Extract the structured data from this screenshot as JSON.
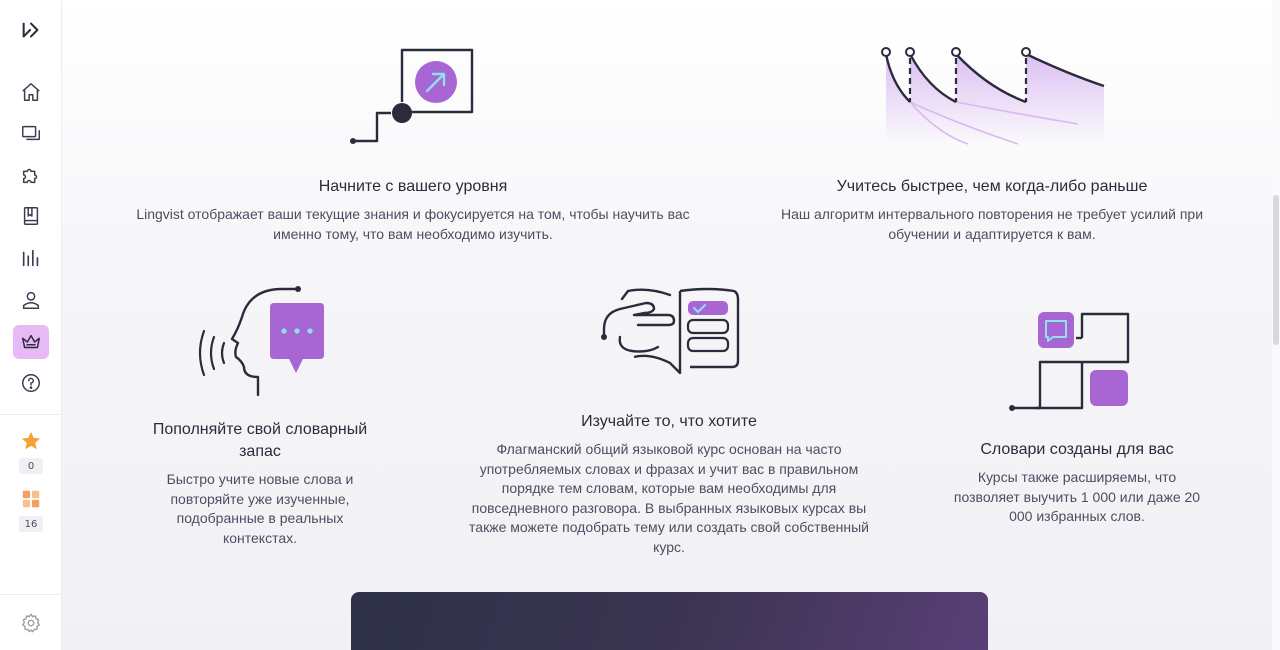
{
  "sidebar": {
    "logo_icon": "lingvist-logo-icon",
    "items": [
      {
        "name": "home",
        "icon": "home-icon"
      },
      {
        "name": "cards",
        "icon": "cards-icon"
      },
      {
        "name": "challenges",
        "icon": "puzzle-icon"
      },
      {
        "name": "courses",
        "icon": "book-icon"
      },
      {
        "name": "stats",
        "icon": "chart-icon"
      },
      {
        "name": "profile",
        "icon": "user-icon"
      },
      {
        "name": "premium",
        "icon": "crown-icon",
        "active": true
      },
      {
        "name": "help",
        "icon": "help-icon"
      }
    ],
    "streak_count": "0",
    "words_count": "16",
    "settings_icon": "gear-icon"
  },
  "features": [
    {
      "title": "Начните с вашего уровня",
      "text": "Lingvist отображает ваши текущие знания и фокусируется на том, чтобы научить вас именно тому, что вам необходимо изучить."
    },
    {
      "title": "Учитесь быстрее, чем когда-либо раньше",
      "text": "Наш алгоритм интервального повторения не требует усилий при обучении и адаптируется к вам."
    },
    {
      "title": "Пополняйте свой словарный запас",
      "text": "Быстро учите новые слова и повторяйте уже изученные, подобранные в реальных контекстах."
    },
    {
      "title": "Изучайте то, что хотите",
      "text": "Флагманский общий языковой курс основан на часто употребляемых словах и фразах и учит вас в правильном порядке тем словам, которые вам необходимы для повседневного разговора. В выбранных языковых курсах вы также можете подобрать тему или создать свой собственный курс."
    },
    {
      "title": "Словари созданы для вас",
      "text": "Курсы также расширяемы, что позволяет выучить 1 000 или даже 20 000 избранных слов."
    }
  ],
  "colors": {
    "accent": "#a865d4",
    "accent_light": "#e7b9f5",
    "ink": "#2a2c3c",
    "cyan": "#8fe1f0",
    "star": "#f4a237",
    "squares": "#f5b27a"
  }
}
